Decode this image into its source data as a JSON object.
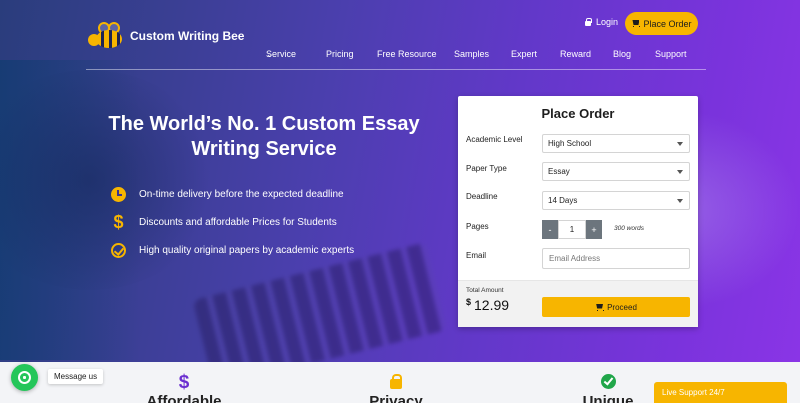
{
  "brand": {
    "name": "Custom Writing Bee"
  },
  "header": {
    "login_label": "Login",
    "place_order_label": "Place Order",
    "nav": [
      "Service",
      "Pricing",
      "Free Resource",
      "Samples",
      "Expert",
      "Reward",
      "Blog",
      "Support"
    ]
  },
  "hero": {
    "headline": "The World’s No. 1 Custom Essay Writing Service",
    "features": [
      {
        "icon": "clock-icon",
        "text": "On-time delivery before the expected deadline"
      },
      {
        "icon": "dollar-icon",
        "text": "Discounts and affordable Prices for Students"
      },
      {
        "icon": "check-circle-icon",
        "text": "High quality original papers by academic experts"
      }
    ]
  },
  "order_form": {
    "title": "Place Order",
    "academic_level_label": "Academic Level",
    "academic_level_value": "High School",
    "paper_type_label": "Paper Type",
    "paper_type_value": "Essay",
    "deadline_label": "Deadline",
    "deadline_value": "14 Days",
    "pages_label": "Pages",
    "pages_value": "1",
    "minus": "-",
    "plus": "+",
    "words": "300 words",
    "email_label": "Email",
    "email_placeholder": "Email Address",
    "total_label": "Total Amount",
    "currency": "$",
    "total_value": "12.99",
    "proceed_label": "Proceed"
  },
  "bottom": {
    "cards": [
      {
        "icon": "dollar-icon",
        "title": "Affordable"
      },
      {
        "icon": "lock-icon",
        "title": "Privacy"
      },
      {
        "icon": "check-circle-icon",
        "title": "Unique"
      }
    ],
    "message_us": "Message us",
    "live_support": "Live Support 24/7"
  },
  "colors": {
    "accent": "#f7b500",
    "purple": "#6b2fd0",
    "whatsapp": "#25c65a"
  }
}
